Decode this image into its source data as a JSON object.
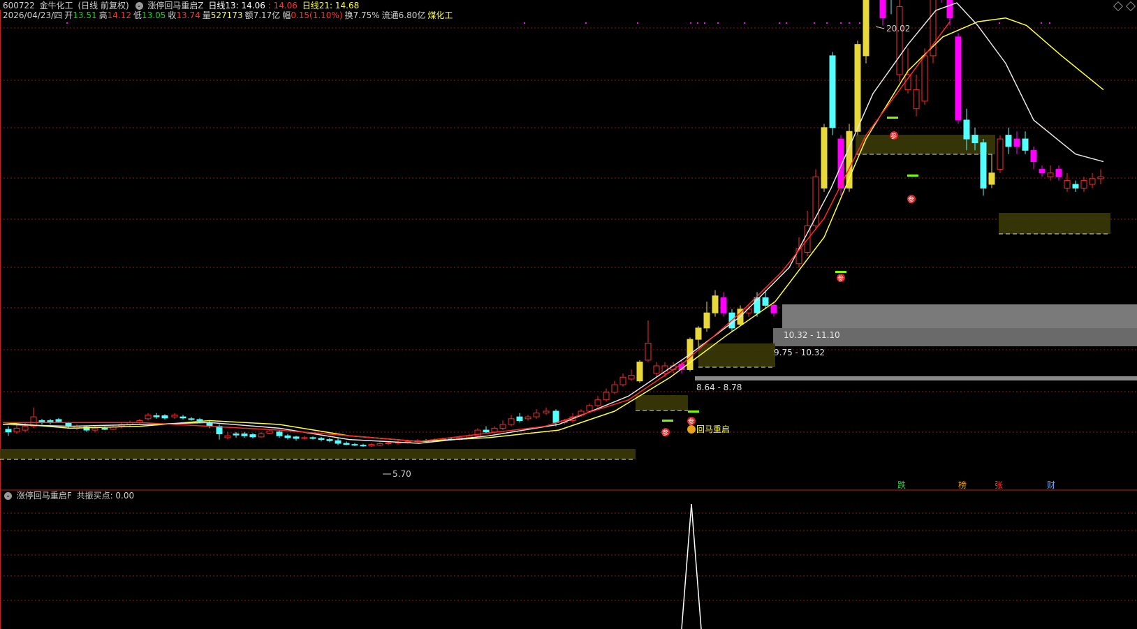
{
  "header": {
    "code": "600722",
    "name": "金牛化工",
    "period": "(日线 前复权)",
    "indicator_name": "涨停回马重启Z",
    "ma13_label": "日线13: 14.06",
    "ma13_extra": ": 14.06",
    "ma21_label": "日线21: 14.68",
    "date": "2026/04/23/四",
    "open_label": "开",
    "open": "13.51",
    "high_label": "高",
    "high": "14.12",
    "low_label": "低",
    "low": "13.05",
    "close_label": "收",
    "close": "13.74",
    "vol_label": "量",
    "vol": "527173",
    "amount_label": "额",
    "amount": "7.17亿",
    "change_label": "幅",
    "change": "0.15(1.10%)",
    "turnover_label": "换",
    "turnover": "7.75%",
    "float_label": "流通",
    "float": "6.80亿",
    "sector": "煤化工"
  },
  "subpanel": {
    "indicator_name": "涨停回马重启F",
    "resonance": "共振买点: 0.00"
  },
  "annotations": {
    "peak": "20.02",
    "low": "5.70",
    "zone1": "8.64 - 8.78",
    "zone2": "9.75 - 10.32",
    "zone3": "10.32 - 11.10",
    "signal": "回马重启",
    "ci": "参"
  },
  "tags": [
    {
      "label": "跌",
      "color": "#2ecc40"
    },
    {
      "label": "榜",
      "color": "#e8a317"
    },
    {
      "label": "张",
      "color": "#ff3030"
    },
    {
      "label": "财",
      "color": "#6aa8ff"
    }
  ],
  "colors": {
    "up": "#ff2828",
    "down": "#54ffff",
    "ma_white": "#e6e6e6",
    "ma_yellow": "#ffff33",
    "ma_red": "#ff2828",
    "grid": "#8b1a1a",
    "magenta": "#ff00ff",
    "gold": "#e8d83c"
  }
}
